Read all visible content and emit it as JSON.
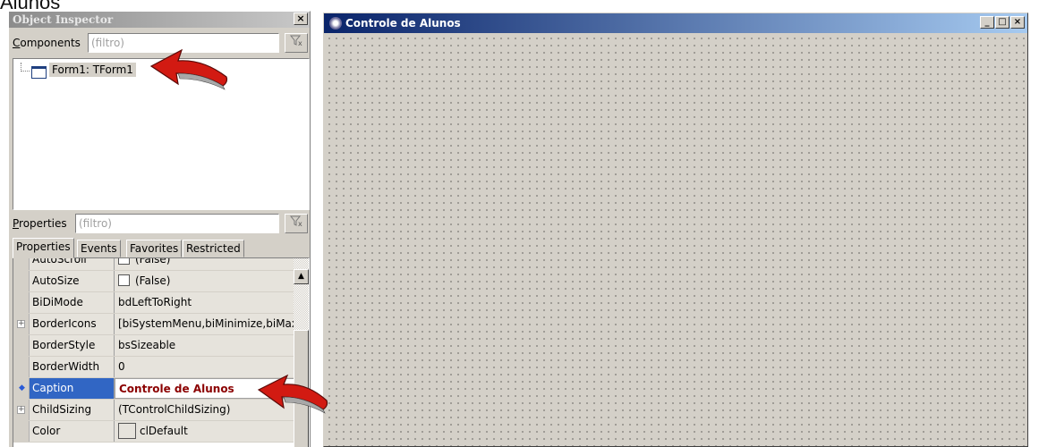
{
  "background_caption": "Alunos",
  "object_inspector": {
    "title": "Object Inspector",
    "close_glyph": "×",
    "components_label_u": "C",
    "components_label_rest": "omponents",
    "components_placeholder": "(filtro)",
    "tree_item": "Form1: TForm1",
    "properties_label_u": "P",
    "properties_label_rest": "roperties",
    "properties_placeholder": "(filtro)",
    "tabs": [
      "Properties",
      "Events",
      "Favorites",
      "Restricted"
    ],
    "grid": [
      {
        "name": "AutoScroll",
        "value": "(False)",
        "kind": "check"
      },
      {
        "name": "AutoSize",
        "value": "(False)",
        "kind": "check"
      },
      {
        "name": "BiDiMode",
        "value": "bdLeftToRight",
        "kind": "text"
      },
      {
        "name": "BorderIcons",
        "value": "[biSystemMenu,biMinimize,biMaximize]",
        "kind": "expand"
      },
      {
        "name": "BorderStyle",
        "value": "bsSizeable",
        "kind": "text"
      },
      {
        "name": "BorderWidth",
        "value": "0",
        "kind": "text"
      },
      {
        "name": "Caption",
        "value": "Controle de Alunos",
        "kind": "selected"
      },
      {
        "name": "ChildSizing",
        "value": "(TControlChildSizing)",
        "kind": "expand"
      },
      {
        "name": "Color",
        "value": "clDefault",
        "kind": "color"
      }
    ]
  },
  "form_window": {
    "title": "Controle de Alunos",
    "minimize_glyph": "_",
    "maximize_glyph": "□",
    "close_glyph": "×"
  },
  "colors": {
    "title_gradient_start": "#0a246a",
    "selection": "#3166c4",
    "caption_value": "#8b0000",
    "arrow": "#d21a12"
  }
}
